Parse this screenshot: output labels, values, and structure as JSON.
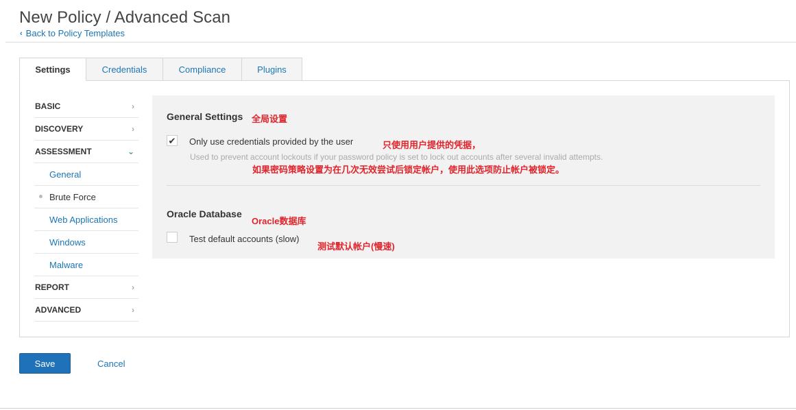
{
  "header": {
    "title": "New Policy / Advanced Scan",
    "back_label": "Back to Policy Templates"
  },
  "tabs": [
    {
      "label": "Settings",
      "active": true
    },
    {
      "label": "Credentials",
      "active": false
    },
    {
      "label": "Compliance",
      "active": false
    },
    {
      "label": "Plugins",
      "active": false
    }
  ],
  "sidebar": {
    "basic": "BASIC",
    "discovery": "DISCOVERY",
    "assessment": "ASSESSMENT",
    "sub_items": [
      "General",
      "Brute Force",
      "Web Applications",
      "Windows",
      "Malware"
    ],
    "current_sub": "Brute Force",
    "report": "REPORT",
    "advanced": "ADVANCED"
  },
  "general_settings": {
    "title": "General Settings",
    "annotation": "全局设置",
    "option_label": "Only use credentials provided by the user",
    "option_checked": true,
    "option_annotation": "只使用用户提供的凭据，",
    "help_text": "Used to prevent account lockouts if your password policy is set to lock out accounts after several invalid attempts.",
    "help_annotation": "如果密码策略设置为在几次无效尝试后锁定帐户，使用此选项防止帐户被锁定。"
  },
  "oracle_database": {
    "title": "Oracle Database",
    "annotation": "Oracle数据库",
    "option_label": "Test default accounts (slow)",
    "option_checked": false,
    "option_annotation": "测试默认帐户(慢速)"
  },
  "footer": {
    "save_label": "Save",
    "cancel_label": "Cancel"
  },
  "colors": {
    "link": "#1b76b5",
    "annotation_red": "#e0242b",
    "save_button": "#1f72b8",
    "expanded_arrow": "#4aa564"
  },
  "icons": {
    "back": "chevron-left-icon",
    "collapsed": "chevron-right-icon",
    "expanded": "chevron-down-icon",
    "checked": "checkmark-icon"
  }
}
